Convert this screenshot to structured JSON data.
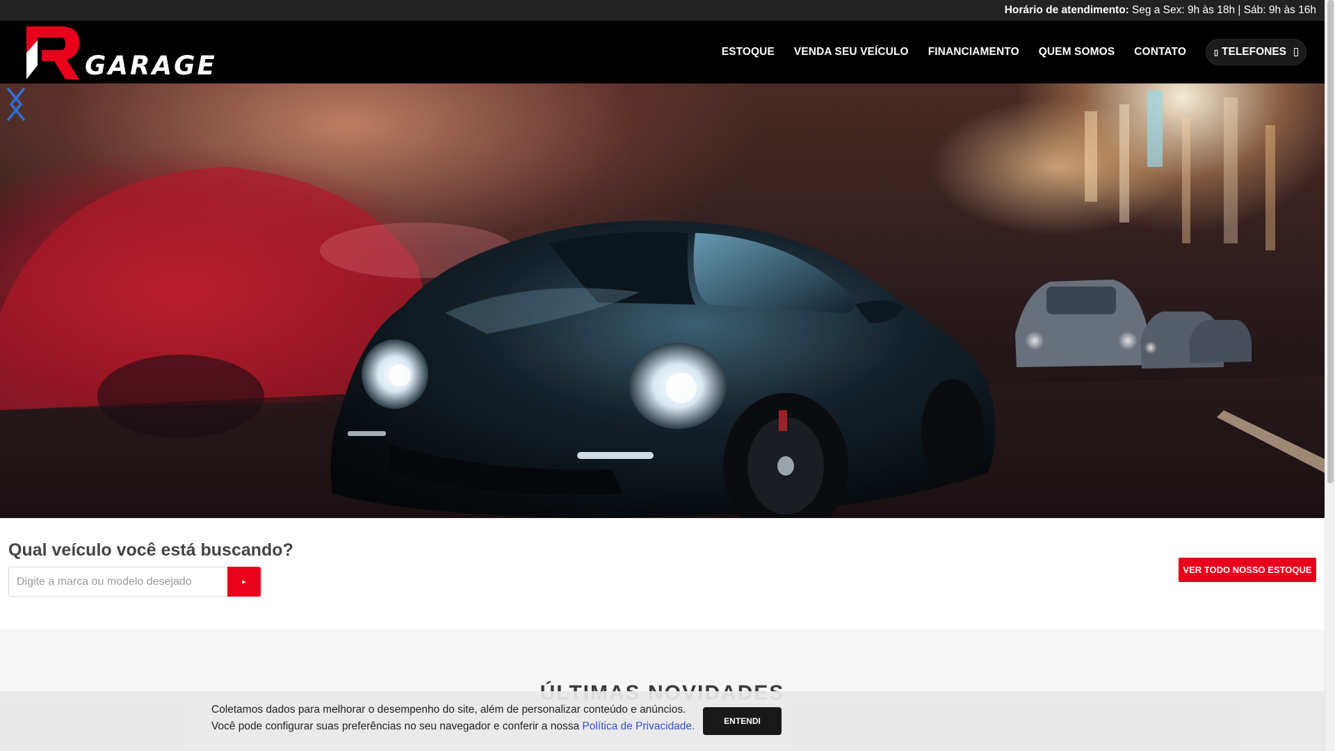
{
  "topbar": {
    "hours_label": "Horário de atendimento:",
    "hours_value": "Seg a Sex: 9h às 18h | Sáb: 9h às 16h"
  },
  "brand": {
    "logo_text": "GARAGE",
    "logo_letter": "R",
    "accent_color": "#e8001c"
  },
  "nav": {
    "items": [
      {
        "label": "ESTOQUE"
      },
      {
        "label": "VENDA SEU VEÍCULO"
      },
      {
        "label": "FINANCIAMENTO"
      },
      {
        "label": "QUEM SOMOS"
      },
      {
        "label": "CONTATO"
      }
    ],
    "phones_label": "TELEFONES",
    "phones_icon": "phone-icon"
  },
  "hero": {
    "image_description": "",
    "prev_icon": "chevron-left-icon",
    "next_icon": "chevron-right-icon"
  },
  "search": {
    "title": "Qual veículo você está buscando?",
    "placeholder": "Digite a marca ou modelo desejado",
    "button_icon": "search-icon",
    "stock_button": "VER TODO NOSSO ESTOQUE"
  },
  "news": {
    "title": "ÚLTIMAS NOVIDADES"
  },
  "cookie": {
    "line1": "Coletamos dados para melhorar o desempenho do site, além de personalizar conteúdo e anúncios.",
    "line2": "Você pode configurar suas preferências no seu navegador e conferir a nossa",
    "link": "Política de Privacidade.",
    "button": "ENTENDI"
  }
}
